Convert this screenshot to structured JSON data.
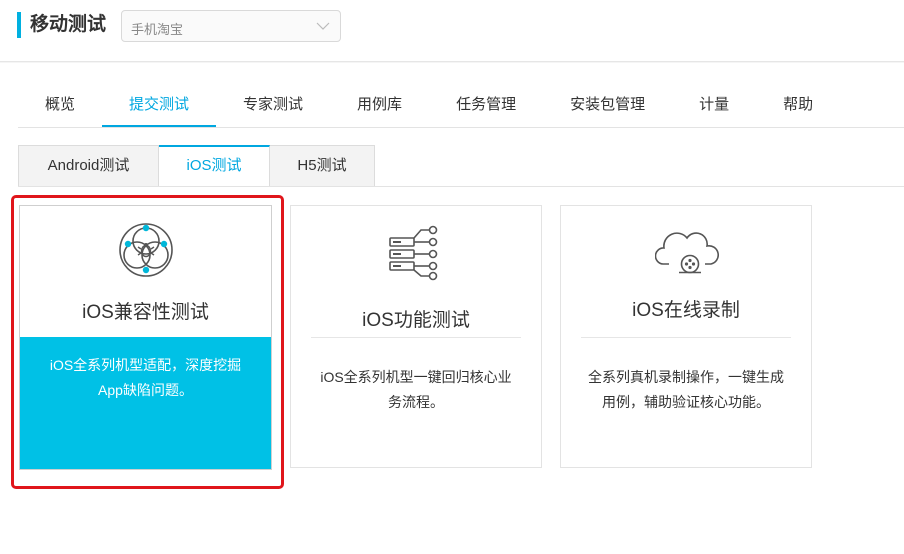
{
  "header": {
    "title": "移动测试",
    "app_select": {
      "value": "手机淘宝"
    },
    "accent_color": "#00b0e0"
  },
  "nav": {
    "items": [
      {
        "label": "概览"
      },
      {
        "label": "提交测试",
        "active": true
      },
      {
        "label": "专家测试"
      },
      {
        "label": "用例库"
      },
      {
        "label": "任务管理"
      },
      {
        "label": "安装包管理"
      },
      {
        "label": "计量"
      },
      {
        "label": "帮助"
      }
    ]
  },
  "subtabs": {
    "items": [
      {
        "label": "Android测试"
      },
      {
        "label": "iOS测试",
        "active": true
      },
      {
        "label": "H5测试"
      }
    ]
  },
  "cards": [
    {
      "title": "iOS兼容性测试",
      "desc": [
        "iOS全系列机型适配，深度挖掘",
        "App缺陷问题。"
      ],
      "icon": "compatibility-icon",
      "highlighted": true
    },
    {
      "title": "iOS功能测试",
      "desc": [
        "iOS全系列机型一键回归核心业",
        "务流程。"
      ],
      "icon": "server-stack-icon"
    },
    {
      "title": "iOS在线录制",
      "desc": [
        "全系列真机录制操作，一键生成",
        "用例，辅助验证核心功能。"
      ],
      "icon": "cloud-record-icon"
    }
  ],
  "colors": {
    "active": "#00a7e0",
    "featured_bg": "#00c1e6",
    "highlight_border": "#e0151b"
  }
}
